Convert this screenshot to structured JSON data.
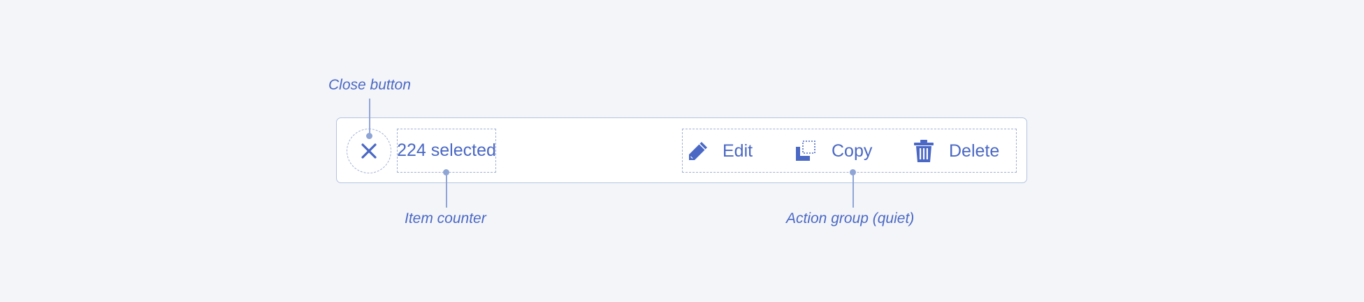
{
  "toolbar": {
    "counter": "224 selected",
    "actions": [
      {
        "label": "Edit",
        "icon": "pencil-icon"
      },
      {
        "label": "Copy",
        "icon": "copy-icon"
      },
      {
        "label": "Delete",
        "icon": "trash-icon"
      }
    ],
    "close_icon": "close-icon"
  },
  "annotations": {
    "close": "Close button",
    "counter": "Item counter",
    "group": "Action group (quiet)"
  },
  "colors": {
    "background": "#f4f5f9",
    "accent": "#4a68c4",
    "guide": "#9fb0d6",
    "bar_border": "#b4c4e0"
  }
}
